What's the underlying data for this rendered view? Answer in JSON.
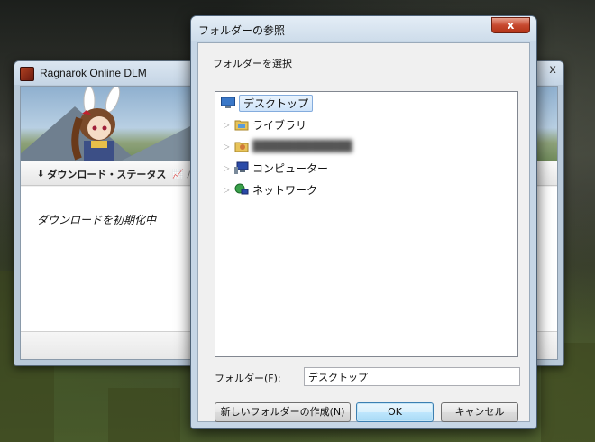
{
  "back_window": {
    "title": "Ragnarok Online DLM",
    "tabs": [
      {
        "label": "ダウンロード・ステータス"
      },
      {
        "label": "パ"
      }
    ],
    "status": "ダウンロードを初期化中"
  },
  "dialog": {
    "title": "フォルダーの参照",
    "close_glyph": "x",
    "instruction": "フォルダーを選択",
    "tree": [
      {
        "label": "デスクトップ",
        "icon": "desktop-icon",
        "selected": true,
        "expander": false
      },
      {
        "label": "ライブラリ",
        "icon": "library-folder-icon",
        "selected": false,
        "expander": true
      },
      {
        "label": "████████████",
        "icon": "user-folder-icon",
        "selected": false,
        "expander": true,
        "blurred": true
      },
      {
        "label": "コンピューター",
        "icon": "computer-icon",
        "selected": false,
        "expander": true
      },
      {
        "label": "ネットワーク",
        "icon": "network-icon",
        "selected": false,
        "expander": true
      }
    ],
    "folder_label": "フォルダー(F):",
    "folder_value": "デスクトップ",
    "buttons": {
      "new_folder": "新しいフォルダーの作成(N)",
      "ok": "OK",
      "cancel": "キャンセル"
    }
  },
  "colors": {
    "accent": "#3c7fb1",
    "selection": "#cfe4fa",
    "close_button": "#c7492f"
  }
}
